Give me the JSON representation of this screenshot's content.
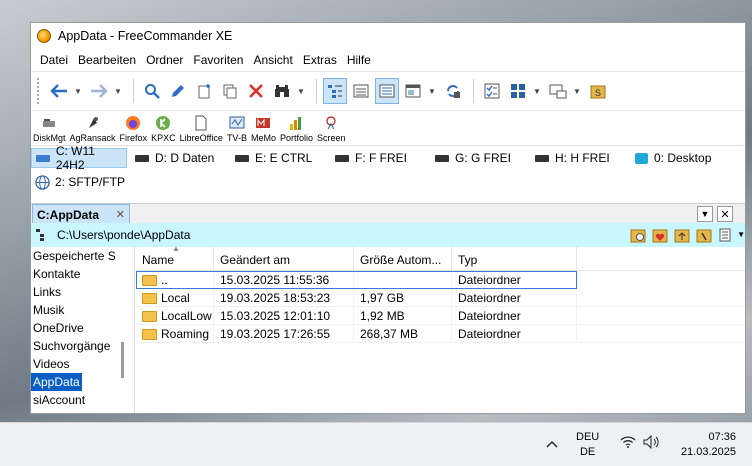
{
  "window": {
    "title": "AppData - FreeCommander XE"
  },
  "menu": [
    "Datei",
    "Bearbeiten",
    "Ordner",
    "Favoriten",
    "Ansicht",
    "Extras",
    "Hilfe"
  ],
  "quickbar": [
    {
      "label": "DiskMgt",
      "icon": "disk-mgmt-icon"
    },
    {
      "label": "AgRansack",
      "icon": "agent-ransack-icon"
    },
    {
      "label": "Firefox",
      "icon": "firefox-icon"
    },
    {
      "label": "KPXC",
      "icon": "keepassxc-icon"
    },
    {
      "label": "LibreOffice",
      "icon": "libreoffice-icon"
    },
    {
      "label": "TV-B",
      "icon": "tv-browser-icon"
    },
    {
      "label": "MeMo",
      "icon": "memo-icon"
    },
    {
      "label": "Portfolio",
      "icon": "portfolio-icon"
    },
    {
      "label": "Screen",
      "icon": "screen-icon"
    }
  ],
  "drives": [
    {
      "label": "C: W11 24H2"
    },
    {
      "label": "D: D Daten"
    },
    {
      "label": "E: E CTRL"
    },
    {
      "label": "F: F FREI"
    },
    {
      "label": "G: G FREI"
    },
    {
      "label": "H: H FREI"
    },
    {
      "label": "0: Desktop"
    },
    {
      "label": "2: SFTP/FTP"
    }
  ],
  "tab": {
    "label": "C:AppData",
    "close": "✕"
  },
  "path": "C:\\Users\\ponde\\AppData",
  "tree": [
    "Gespeicherte S",
    "Kontakte",
    "Links",
    "Musik",
    "OneDrive",
    "Suchvorgänge",
    "Videos",
    "AppData",
    "siAccount"
  ],
  "columns": [
    "Name",
    "Geändert am",
    "Größe Autom...",
    "Typ"
  ],
  "rows": [
    {
      "name": "..",
      "date": "15.03.2025 11:55:36",
      "size": "",
      "type": "Dateiordner"
    },
    {
      "name": "Local",
      "date": "19.03.2025 18:53:23",
      "size": "1,97 GB",
      "type": "Dateiordner"
    },
    {
      "name": "LocalLow",
      "date": "15.03.2025 12:01:10",
      "size": "1,92 MB",
      "type": "Dateiordner"
    },
    {
      "name": "Roaming",
      "date": "19.03.2025 17:26:55",
      "size": "268,37 MB",
      "type": "Dateiordner"
    }
  ],
  "taskbar": {
    "lang1": "DEU",
    "lang2": "DE",
    "time": "07:36",
    "date": "21.03.2025"
  },
  "colors": {
    "accent": "#0a5fc4",
    "path_bg": "#c9f6ff",
    "tab_bg": "#cce4f7"
  }
}
